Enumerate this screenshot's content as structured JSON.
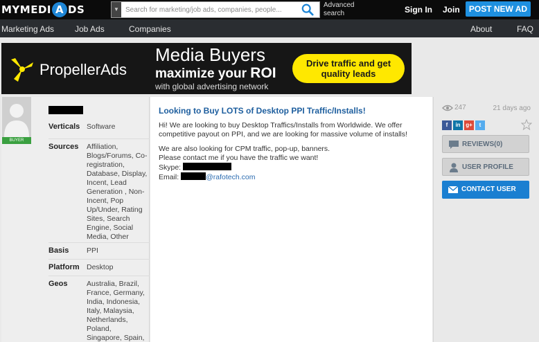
{
  "header": {
    "logo_part1": "MYMEDI",
    "logo_circle": "A",
    "logo_part2": "DS",
    "search_placeholder": "Search for marketing/job ads, companies, people...",
    "advanced_search": "Advanced search",
    "sign_in": "Sign In",
    "join": "Join",
    "post_new_ad": "POST NEW AD"
  },
  "nav": {
    "items": [
      "Marketing Ads",
      "Job Ads",
      "Companies"
    ],
    "right_items": [
      "About",
      "FAQ"
    ]
  },
  "banner": {
    "brand": "PropellerAds",
    "headline": "Media Buyers",
    "sub1": "maximize your",
    "sub1_strong": "ROI",
    "sub2": "with global advertising network",
    "cta": "Drive traffic and get quality leads",
    "accent": "#ffe800"
  },
  "profile": {
    "badge": "BUYER",
    "fields": [
      {
        "label": "Verticals",
        "value": "Software"
      },
      {
        "label": "Sources",
        "value": "Affiliation, Blogs/Forums, Co-registration, Database, Display, Incent, Lead Generation , Non-Incent, Pop Up/Under, Rating Sites, Search Engine, Social Media, Other"
      },
      {
        "label": "Basis",
        "value": "PPI"
      },
      {
        "label": "Platform",
        "value": "Desktop"
      },
      {
        "label": "Geos",
        "value": "Australia, Brazil, France, Germany, India, Indonesia, Italy, Malaysia, Netherlands, Poland, Singapore, Spain,"
      }
    ]
  },
  "post": {
    "title": "Looking to Buy LOTS of Desktop PPI Traffic/Installs!",
    "para1": "Hi! We are looking to buy Desktop Traffics/Installs from Worldwide. We offer competitive payout on PPI, and we are looking for massive volume of installs!",
    "line2a": "We are also looking for CPM traffic, pop-up, banners.",
    "line2b": "Please contact me if you have the traffic we want!",
    "skype_label": "Skype:",
    "email_label": "Email:",
    "email_domain": "@rafotech.com"
  },
  "sidebar": {
    "views": "247",
    "date": "21 days ago",
    "social": [
      "f",
      "in",
      "g+",
      "t"
    ],
    "reviews": "REVIEWS(0)",
    "user_profile": "USER PROFILE",
    "contact_user": "CONTACT USER"
  }
}
